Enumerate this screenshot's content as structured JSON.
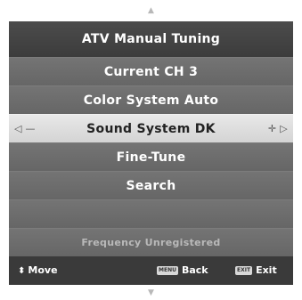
{
  "menu": {
    "title": "ATV Manual Tuning",
    "items": [
      {
        "label": "Current CH 3"
      },
      {
        "label": "Color System Auto"
      },
      {
        "label": "Sound System DK",
        "left_glyph": "◁ —",
        "right_glyph": "✛ ▷"
      },
      {
        "label": "Fine-Tune"
      },
      {
        "label": "Search"
      },
      {
        "label": ""
      }
    ],
    "status": "Frequency Unregistered"
  },
  "footer": {
    "move_label": "Move",
    "menu_key": "MENU",
    "back_label": "Back",
    "exit_key": "EXIT",
    "exit_label": "Exit"
  },
  "icons": {
    "up": "▲",
    "down": "▼",
    "move": "⬍"
  },
  "colors": {
    "selected_background": "#dcdcdc",
    "row_background": "#6e6e6e",
    "title_background": "#444444",
    "footer_background": "#3a3a3a"
  }
}
